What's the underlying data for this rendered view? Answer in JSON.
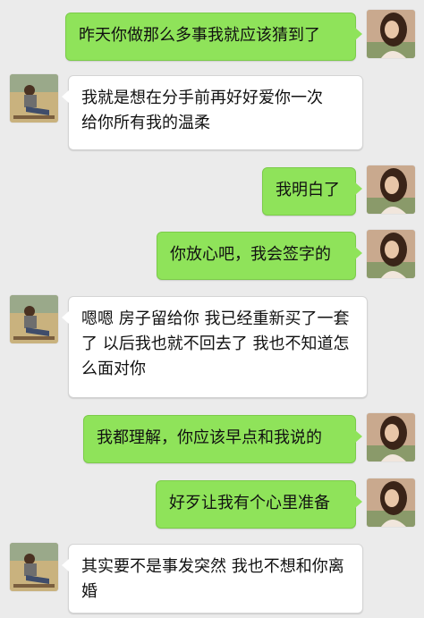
{
  "messages": [
    {
      "side": "right",
      "text": "昨天你做那么多事我就应该猜到了"
    },
    {
      "side": "left",
      "text": "我就是想在分手前再好好爱你一次\n给你所有我的温柔"
    },
    {
      "side": "right",
      "text": "我明白了"
    },
    {
      "side": "right",
      "text": "你放心吧，我会签字的"
    },
    {
      "side": "left",
      "text": "嗯嗯 房子留给你 我已经重新买了一套了 以后我也就不回去了 我也不知道怎么面对你"
    },
    {
      "side": "right",
      "text": "我都理解，你应该早点和我说的"
    },
    {
      "side": "right",
      "text": "好歹让我有个心里准备"
    },
    {
      "side": "left",
      "text": "其实要不是事发突然 我也不想和你离婚"
    }
  ],
  "avatars": {
    "right_icon": "girl-portrait-avatar",
    "left_icon": "man-sitting-outdoors-avatar"
  },
  "colors": {
    "background": "#ebebeb",
    "right_bubble": "#8fe35a",
    "left_bubble": "#ffffff"
  }
}
